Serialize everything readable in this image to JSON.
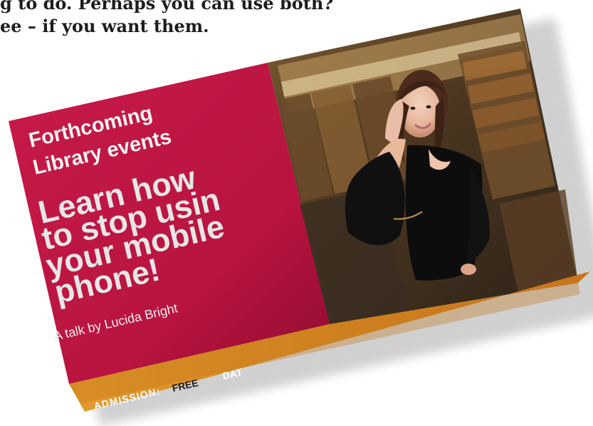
{
  "intro": {
    "line1": "g to do. Perhaps you can use both?",
    "line2": "ee – if you want them."
  },
  "poster": {
    "heading_line1": "Forthcoming",
    "heading_line2": "Library events",
    "title_line1": "Learn how",
    "title_line2": "to stop usin",
    "title_line3": "your mobile",
    "title_line4": "phone!",
    "subtitle": "A talk by Lucida Bright",
    "admission_label": "ADMISSION:",
    "admission_value": "FREE",
    "date_label": "DAT"
  },
  "colors": {
    "crimson": "#b8143f",
    "crimson_dark": "#8f0c31",
    "orange": "#d9821f",
    "orange_dark": "#b86817",
    "heading": "#f3f3f3",
    "title": "#e6e6e6",
    "admission_text": "#ffffff",
    "admission_value": "#1a1a1a"
  }
}
